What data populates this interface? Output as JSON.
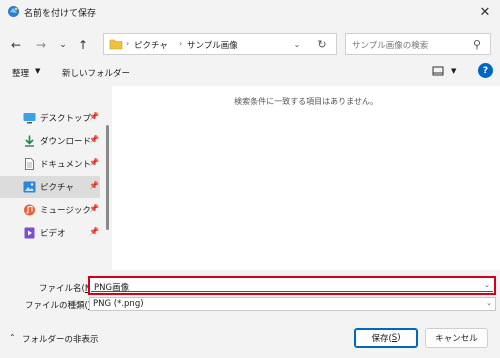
{
  "window": {
    "title": "名前を付けて保存",
    "close": "✕"
  },
  "address": {
    "segments": [
      "ピクチャ",
      "サンプル画像"
    ],
    "separator": "›"
  },
  "search": {
    "placeholder": "サンプル画像の検索"
  },
  "commands": {
    "organize": "整理",
    "new_folder": "新しいフォルダー"
  },
  "nav": {
    "items": [
      {
        "label": "デスクトップ",
        "icon": "desktop-icon"
      },
      {
        "label": "ダウンロード",
        "icon": "download-icon"
      },
      {
        "label": "ドキュメント",
        "icon": "documents-icon"
      },
      {
        "label": "ピクチャ",
        "icon": "pictures-icon",
        "selected": true
      },
      {
        "label": "ミュージック",
        "icon": "music-icon"
      },
      {
        "label": "ビデオ",
        "icon": "video-icon"
      }
    ]
  },
  "content": {
    "empty_message": "検索条件に一致する項目はありません。"
  },
  "form": {
    "filename_label": "ファイル名(",
    "filename_accel": "N",
    "filename_label_end": "):",
    "filename_value": "PNG画像",
    "filetype_label": "ファイルの種類(",
    "filetype_accel": "T",
    "filetype_label_end": "):",
    "filetype_value": "PNG (*.png)"
  },
  "footer": {
    "hide_folders": "フォルダーの非表示",
    "save_label": "保存(",
    "save_accel": "S",
    "save_label_end": ")",
    "cancel_label": "キャンセル"
  },
  "colors": {
    "accent": "#0067c0",
    "highlight": "#d4001b"
  }
}
